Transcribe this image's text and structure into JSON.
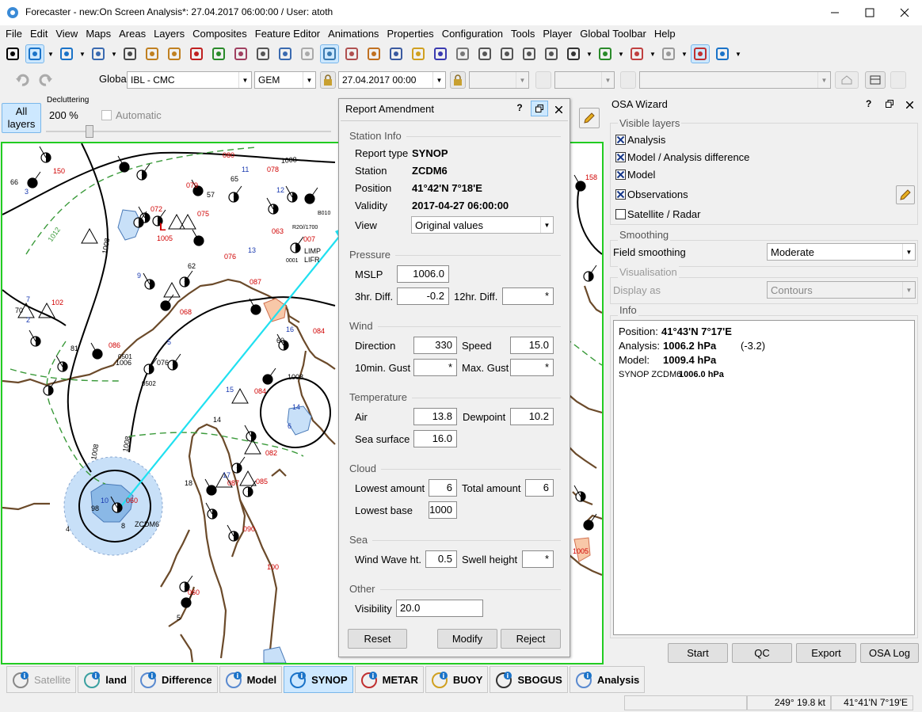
{
  "window": {
    "title": "Forecaster - new:On Screen Analysis*: 27.04.2017 06:00:00 / User: atoth"
  },
  "menu": [
    "File",
    "Edit",
    "View",
    "Maps",
    "Areas",
    "Layers",
    "Composites",
    "Feature Editor",
    "Animations",
    "Properties",
    "Configuration",
    "Tools",
    "Player",
    "Global Toolbar",
    "Help"
  ],
  "toolbar2": {
    "global_label": "Global",
    "model_combo": "IBL - CMC",
    "gem_combo": "GEM",
    "datetime_combo": "27.04.2017 00:00"
  },
  "decluttering": {
    "all_layers": "All\nlayers",
    "title": "Decluttering",
    "percent": "200 %",
    "automatic": "Automatic",
    "automatic_checked": false,
    "slider_fraction": 0.15
  },
  "dialog": {
    "title": "Report Amendment",
    "station_info": {
      "section": "Station Info",
      "report_type_label": "Report type",
      "report_type": "SYNOP",
      "station_label": "Station",
      "station": "ZCDM6",
      "position_label": "Position",
      "position": "41°42'N 7°18'E",
      "validity_label": "Validity",
      "validity": "2017-04-27 06:00:00",
      "view_label": "View",
      "view": "Original values"
    },
    "pressure": {
      "section": "Pressure",
      "mslp_label": "MSLP",
      "mslp": "1006.0",
      "diff3_label": "3hr. Diff.",
      "diff3": "-0.2",
      "diff12_label": "12hr. Diff.",
      "diff12": "*"
    },
    "wind": {
      "section": "Wind",
      "direction_label": "Direction",
      "direction": "330",
      "speed_label": "Speed",
      "speed": "15.0",
      "gust10_label": "10min. Gust",
      "gust10": "*",
      "maxgust_label": "Max. Gust",
      "maxgust": "*"
    },
    "temperature": {
      "section": "Temperature",
      "air_label": "Air",
      "air": "13.8",
      "dew_label": "Dewpoint",
      "dew": "10.2",
      "sea_label": "Sea surface",
      "sea": "16.0"
    },
    "cloud": {
      "section": "Cloud",
      "lowest_amount_label": "Lowest amount",
      "lowest_amount": "6",
      "total_amount_label": "Total amount",
      "total_amount": "6",
      "lowest_base_label": "Lowest base",
      "lowest_base": "1000"
    },
    "sea": {
      "section": "Sea",
      "wave_label": "Wind Wave ht.",
      "wave": "0.5",
      "swell_label": "Swell height",
      "swell": "*"
    },
    "other": {
      "section": "Other",
      "visibility_label": "Visibility",
      "visibility": "20.0"
    },
    "buttons": {
      "reset": "Reset",
      "modify": "Modify",
      "reject": "Reject"
    }
  },
  "osa": {
    "title": "OSA Wizard",
    "visible_layers": "Visible layers",
    "layers": [
      {
        "label": "Analysis",
        "checked": true
      },
      {
        "label": "Model / Analysis difference",
        "checked": true
      },
      {
        "label": "Model",
        "checked": true
      },
      {
        "label": "Observations",
        "checked": true
      },
      {
        "label": "Satellite / Radar",
        "checked": false
      }
    ],
    "smoothing": "Smoothing",
    "field_smoothing_label": "Field smoothing",
    "field_smoothing": "Moderate",
    "visualisation": "Visualisation",
    "display_as_label": "Display as",
    "display_as": "Contours",
    "info": "Info",
    "info_position_label": "Position:",
    "info_position": "41°43'N 7°17'E",
    "info_analysis_label": "Analysis:",
    "info_analysis": "1006.2 hPa",
    "info_analysis_diff": "(-3.2)",
    "info_model_label": "Model:",
    "info_model": "1009.4 hPa",
    "info_synop_label": "SYNOP ZCDM6",
    "info_synop": "1006.0 hPa",
    "buttons": {
      "start": "Start",
      "qc": "QC",
      "export": "Export",
      "log": "OSA Log"
    }
  },
  "layer_tabs": [
    {
      "label": "Satellite",
      "disabled": true
    },
    {
      "label": "land"
    },
    {
      "label": "Difference"
    },
    {
      "label": "Model"
    },
    {
      "label": "SYNOP",
      "active": true
    },
    {
      "label": "METAR"
    },
    {
      "label": "BUOY"
    },
    {
      "label": "SBOGUS"
    },
    {
      "label": "Analysis"
    }
  ],
  "status": {
    "wind": "249° 19.8 kt",
    "position": "41°41'N 7°19'E"
  },
  "map": {
    "station_labels": [
      "ZCDM6",
      "LIMP",
      "LIFR",
      "B010",
      "0001",
      "0501",
      "0502"
    ],
    "isobars": [
      "1008",
      "1008",
      "1008",
      "1008",
      "1008",
      "1012"
    ],
    "red_values": [
      "150",
      "080",
      "078",
      "079",
      "072",
      "075",
      "063",
      "007",
      "102",
      "084",
      "068",
      "086",
      "076",
      "084",
      "087",
      "082",
      "085",
      "087",
      "090",
      "100",
      "060",
      "060",
      "158",
      "1005"
    ],
    "blue_values": [
      "10",
      "11",
      "12",
      "13",
      "14",
      "15",
      "16",
      "9",
      "7",
      "2",
      "3",
      "5",
      "6",
      "17"
    ],
    "black_values": [
      "66",
      "98",
      "70",
      "57",
      "62",
      "60",
      "65",
      "81",
      "1006",
      "076",
      "58",
      "14",
      "18",
      "5",
      "4",
      "8"
    ],
    "pressure_letter": "L",
    "station_code": "R20//1700"
  },
  "colors": {
    "map_bg": "#ffffff",
    "coast": "#6b4a2a",
    "sea_fill": "#c8e0f8",
    "highlight_border": "#22cc22",
    "arrow": "#20e0f0",
    "isobar_dash": "#3a9a3a"
  }
}
